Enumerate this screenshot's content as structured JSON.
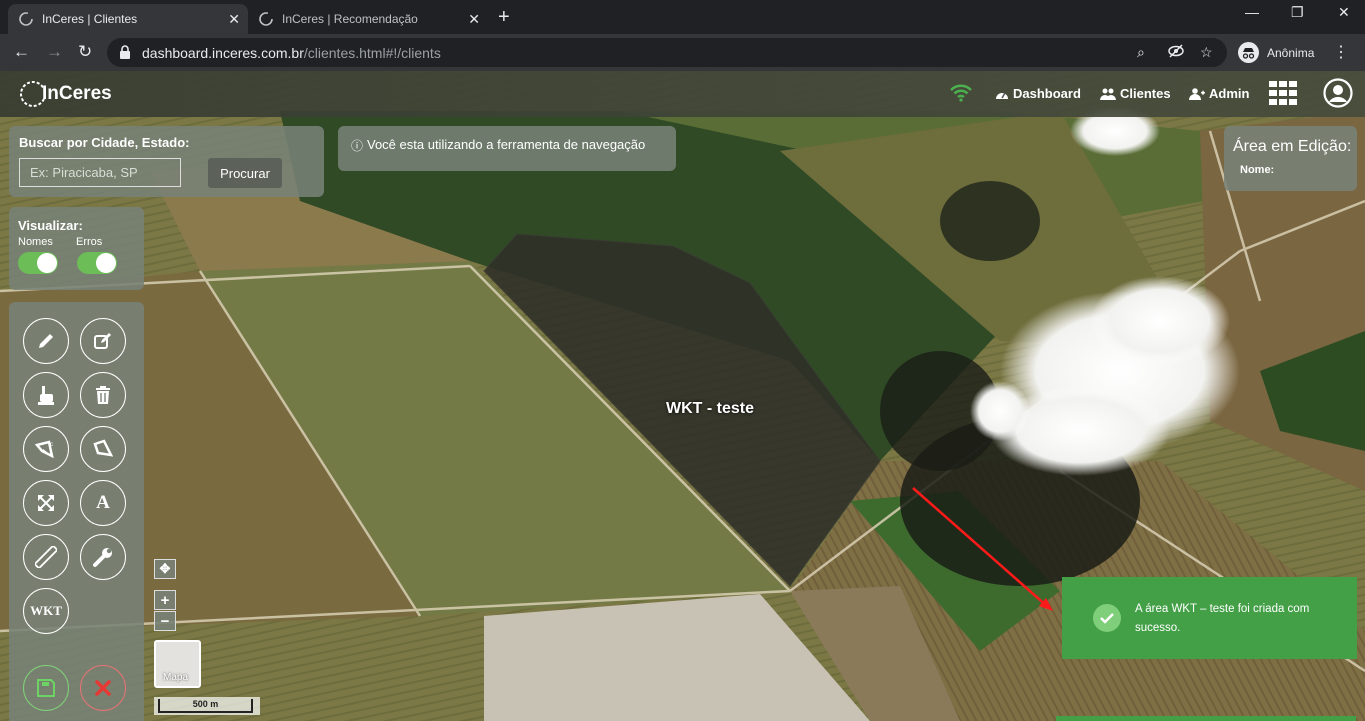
{
  "browser": {
    "tabs": [
      {
        "title": "InCeres | Clientes",
        "active": true
      },
      {
        "title": "InCeres | Recomendação",
        "active": false
      }
    ],
    "url_host": "dashboard.inceres.com.br",
    "url_path": "/clientes.html#!/clients",
    "profile_label": "Anônima",
    "icons": [
      "close-icon",
      "plus-icon",
      "minimize-icon",
      "restore-icon",
      "back-icon",
      "forward-icon",
      "reload-icon",
      "lock-icon",
      "zoom-icon",
      "eye-off-icon",
      "star-icon",
      "incognito-icon",
      "kebab-menu-icon"
    ]
  },
  "header": {
    "logo_text": "InCeres",
    "nav": {
      "dashboard": "Dashboard",
      "clients": "Clientes",
      "admin": "Admin"
    },
    "icons": [
      "wifi-icon",
      "grid-apps-icon",
      "user-circle-icon"
    ],
    "wifi_color": "#4caf50"
  },
  "search": {
    "label": "Buscar por Cidade, Estado:",
    "placeholder": "Ex: Piracicaba, SP",
    "button": "Procurar"
  },
  "info_banner": "Você esta utilizando a ferramenta de navegação",
  "visualize": {
    "title": "Visualizar:",
    "names_label": "Nomes",
    "errors_label": "Erros",
    "names_on": true,
    "errors_on": true
  },
  "tools": {
    "wkt_label": "WKT",
    "text_label": "A",
    "icons": [
      "pencil-icon",
      "edit-icon",
      "hand-pointer-icon",
      "trash-icon",
      "polygon-cut-icon",
      "polygon-icon",
      "expand-icon",
      "text-icon",
      "ruler-icon",
      "wrench-icon",
      "wkt-icon",
      "save-icon",
      "cancel-icon"
    ]
  },
  "area_edit": {
    "title": "Área em Edição:",
    "name_label": "Nome:"
  },
  "map": {
    "polygon_label": "WKT - teste",
    "maptype_label": "Mapa",
    "scale_label": "500 m",
    "zoom_in": "+",
    "zoom_out": "−"
  },
  "toast": {
    "message": "A área WKT – teste foi criada com sucesso.",
    "color": "#43a047"
  }
}
